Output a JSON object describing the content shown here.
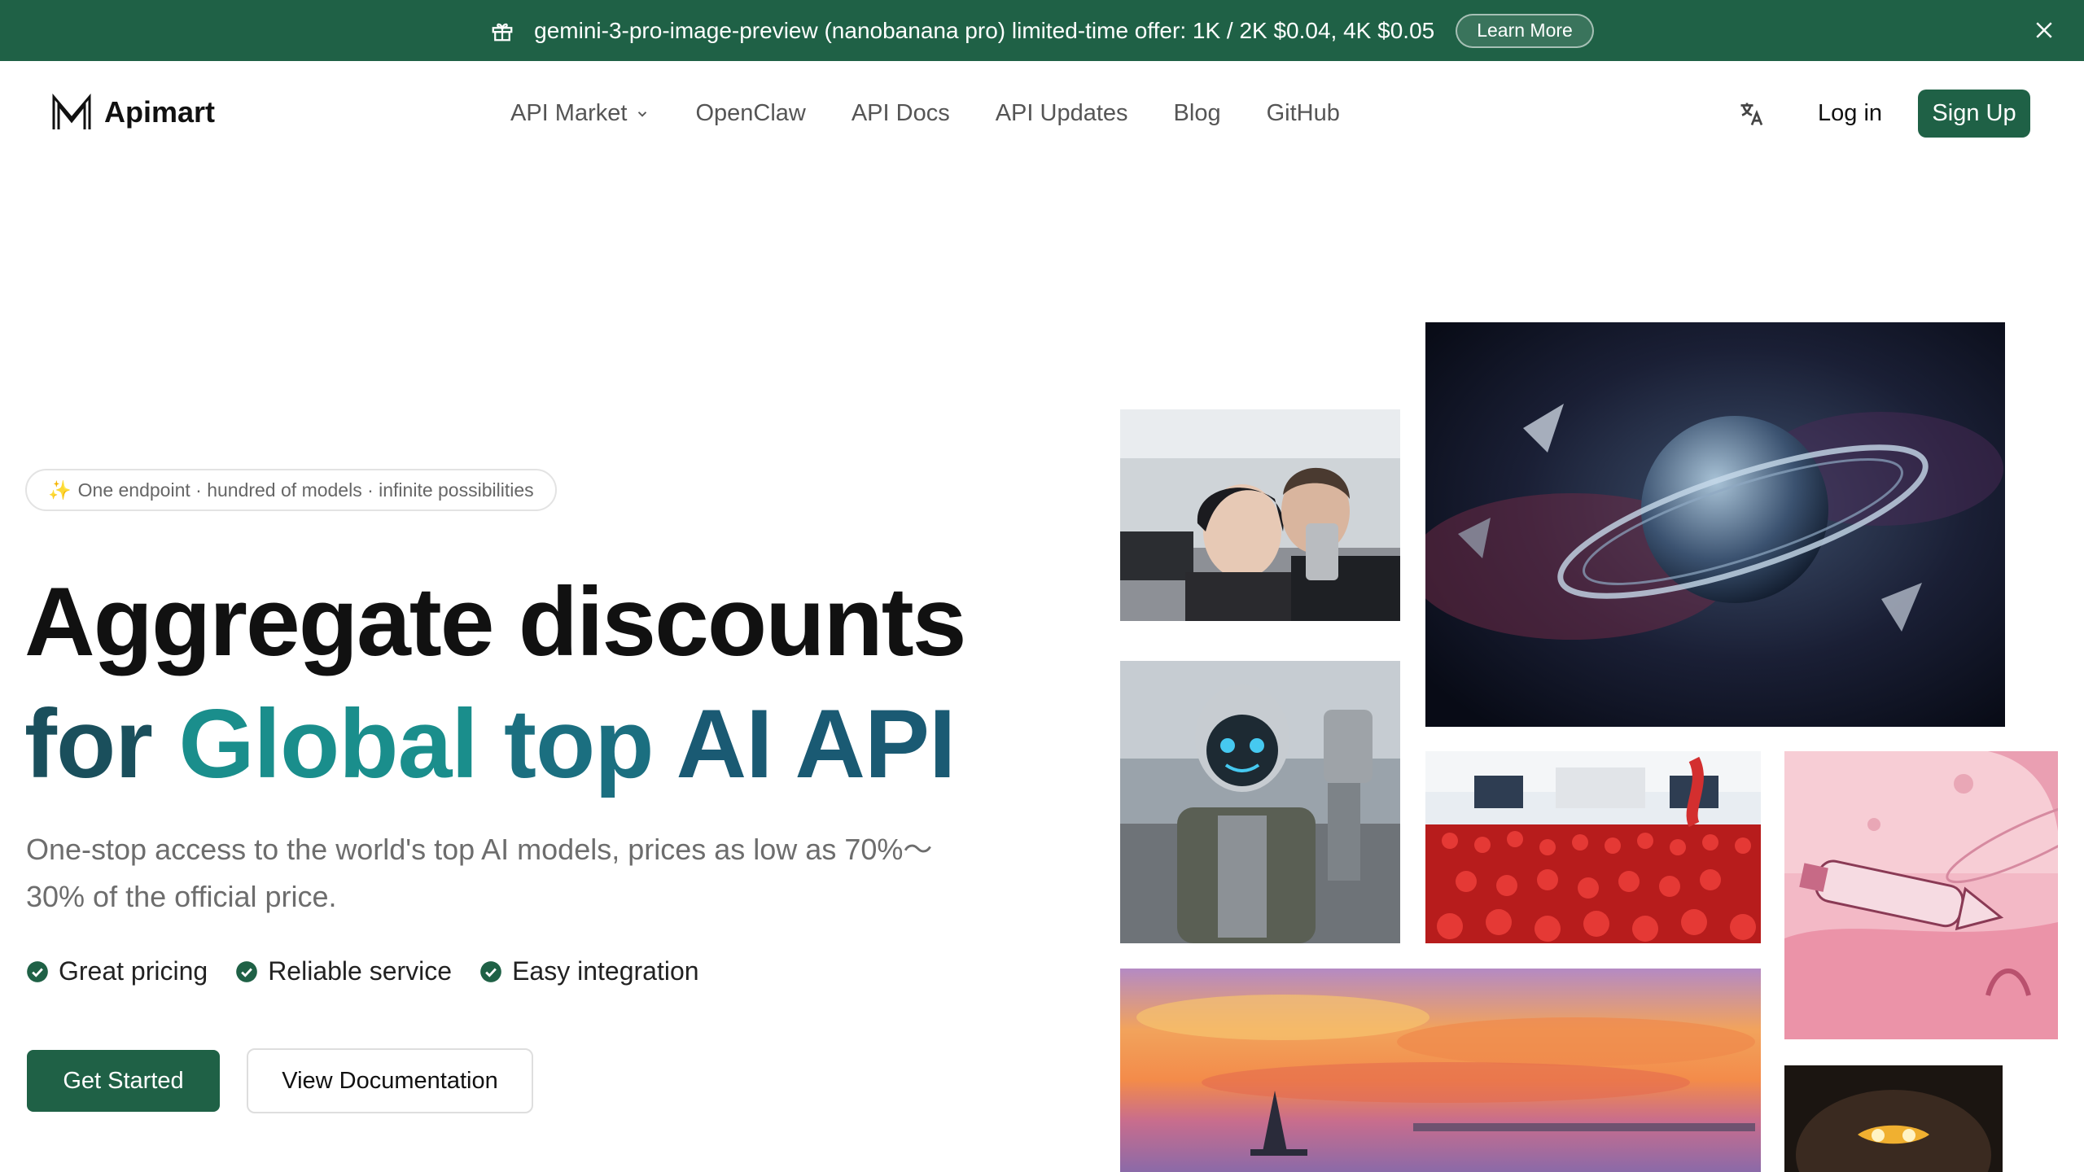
{
  "promo": {
    "text": "gemini-3-pro-image-preview (nanobanana pro) limited-time offer: 1K / 2K $0.04, 4K $0.05",
    "learn_more": "Learn More",
    "icons": [
      "gift-icon",
      "close-icon"
    ]
  },
  "nav": {
    "brand": "Apimart",
    "items": [
      "API Market",
      "OpenClaw",
      "API Docs",
      "API Updates",
      "Blog",
      "GitHub"
    ],
    "login": "Log in",
    "signup": "Sign Up"
  },
  "hero": {
    "tagline": "One endpoint · hundred of models · infinite possibilities",
    "tagline_emoji": "✨",
    "title_line1": "Aggregate discounts",
    "title_line2_words": [
      "for",
      "Global",
      "top",
      "AI API"
    ],
    "description": "One-stop access to the world's top AI models, prices as low as 70%～30% of the official price.",
    "features": [
      "Great pricing",
      "Reliable service",
      "Easy integration"
    ],
    "cta_primary": "Get Started",
    "cta_secondary": "View Documentation"
  },
  "colors": {
    "brand_green": "#1f6146",
    "title_teal": "#1a8e8c",
    "title_dark_teal": "#1a4f5c"
  },
  "gallery": {
    "tiles": [
      "selfie-photo",
      "space-planet-art",
      "robot-selfie-photo",
      "lobster-market-crowd-photo",
      "pink-planet-spaceship-art",
      "sunset-watercolor-painting",
      "monkey-king-art"
    ]
  }
}
